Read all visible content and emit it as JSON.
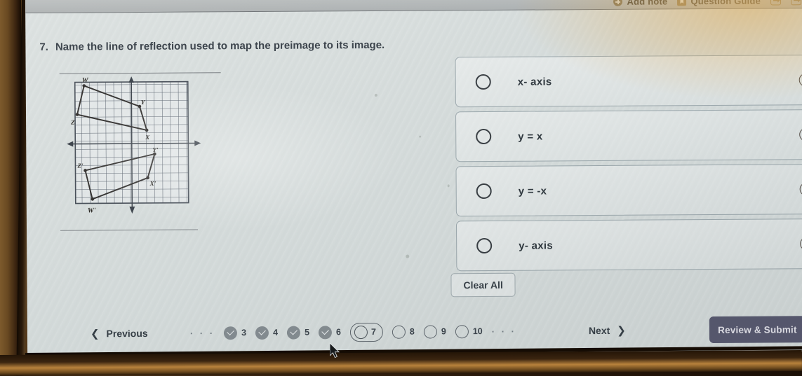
{
  "toolbar": {
    "add_note": "Add note",
    "question_guide": "Question Guide",
    "add_note_icon": "plus-circle-icon",
    "guide_icon": "bookmark-icon",
    "extra_icon_1": "expand-box-icon",
    "extra_icon_2": "expand-box-icon"
  },
  "question": {
    "number": "7.",
    "text": "Name the line of reflection used to map the preimage to its image."
  },
  "figure": {
    "description": "Coordinate grid showing quadrilateral WXYZ and its image W'X'Y'Z'",
    "labels": [
      "W",
      "Z",
      "Y",
      "X",
      "Y'",
      "Z'",
      "X'",
      "W'"
    ],
    "preimage_label": "W",
    "image_label": "W'"
  },
  "options": [
    {
      "id": "opt-x-axis",
      "label": "x- axis",
      "selected": false,
      "eliminate_icon": "minus-circle-icon"
    },
    {
      "id": "opt-y-eq-x",
      "label": "y = x",
      "selected": false,
      "eliminate_icon": "minus-circle-icon"
    },
    {
      "id": "opt-y-eq-neg-x",
      "label": "y = -x",
      "selected": false,
      "eliminate_icon": "minus-circle-icon"
    },
    {
      "id": "opt-y-axis",
      "label": "y- axis",
      "selected": false,
      "eliminate_icon": "minus-circle-icon"
    }
  ],
  "clear_all": "Clear All",
  "nav": {
    "previous": "Previous",
    "previous_chevron": "❮",
    "next": "Next",
    "next_chevron": "❯",
    "review_submit": "Review & Submit",
    "leading_ellipsis": "· · ·",
    "trailing_ellipsis": "· · ·",
    "pages": [
      {
        "num": "3",
        "state": "done"
      },
      {
        "num": "4",
        "state": "done"
      },
      {
        "num": "5",
        "state": "done"
      },
      {
        "num": "6",
        "state": "done"
      },
      {
        "num": "7",
        "state": "current"
      },
      {
        "num": "8",
        "state": "todo"
      },
      {
        "num": "9",
        "state": "todo"
      },
      {
        "num": "10",
        "state": "todo"
      }
    ]
  },
  "colors": {
    "screen_bg": "#d8dedd",
    "toolbar_bg": "#b8bcbc",
    "accent_review": "#4e4e66",
    "text": "#29313a",
    "pager_done": "#80878c"
  }
}
